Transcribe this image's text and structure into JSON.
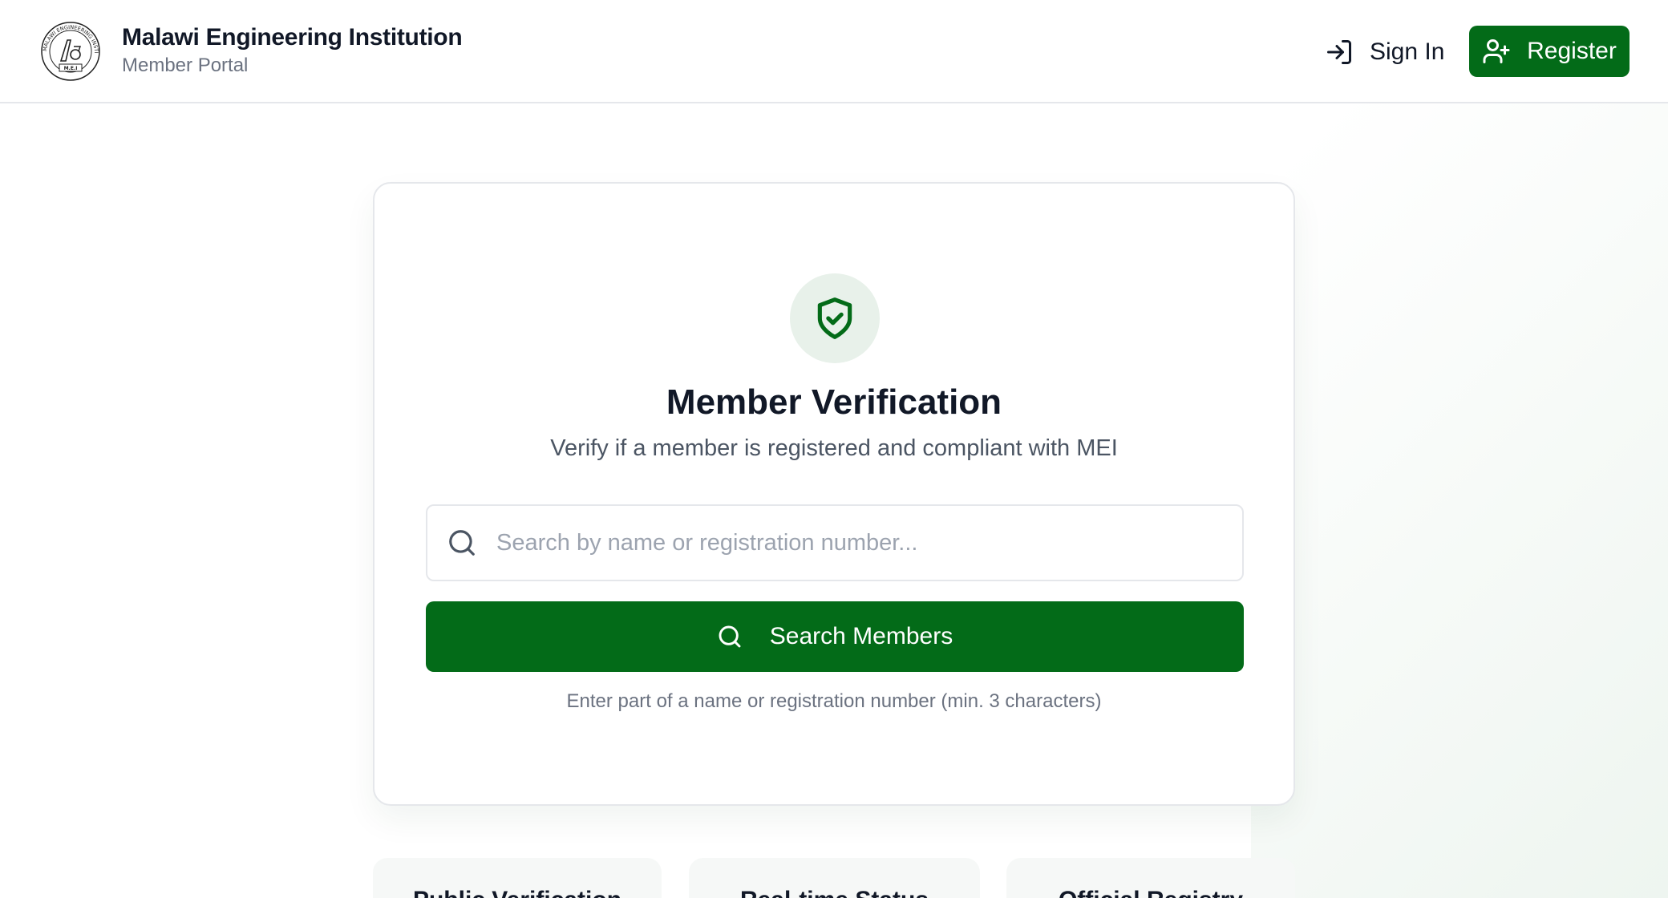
{
  "header": {
    "brand_title": "Malawi Engineering Institution",
    "brand_subtitle": "Member Portal",
    "logo_text": "MALAWI ENGINEERING INSTITUTION",
    "logo_badge": "M.E.I",
    "signin_label": "Sign In",
    "register_label": "Register"
  },
  "verification": {
    "title": "Member Verification",
    "subtitle": "Verify if a member is registered and compliant with MEI",
    "search_placeholder": "Search by name or registration number...",
    "search_value": "",
    "search_button_label": "Search Members",
    "hint": "Enter part of a name or registration number (min. 3 characters)"
  },
  "features": [
    {
      "label": "Public Verification"
    },
    {
      "label": "Real-time Status"
    },
    {
      "label": "Official Registry"
    }
  ],
  "colors": {
    "brand_green": "#036b18",
    "icon_circle_bg": "#e8f1ea"
  },
  "icons": {
    "logo": "mei-seal-logo",
    "signin": "login-arrow-icon",
    "register": "user-plus-icon",
    "shield": "shield-check-icon",
    "search": "search-icon"
  }
}
